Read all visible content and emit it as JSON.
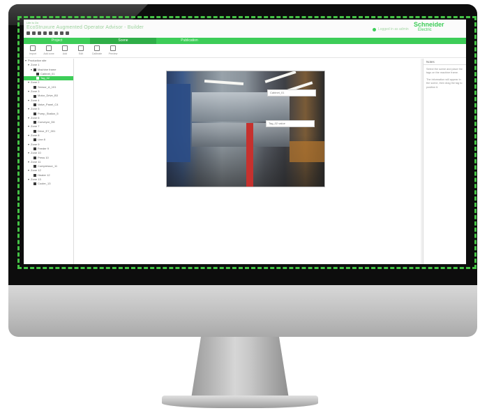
{
  "app": {
    "small_logo": "Life Is On",
    "title": "EcoStruxure Augmented Operator Advisor - Builder",
    "user_text": "Logged in as admin",
    "brand_name": "Schneider",
    "brand_sub": "Electric",
    "accent_color": "#3dcd58"
  },
  "tabs": [
    {
      "label": "Project"
    },
    {
      "label": "Scene"
    },
    {
      "label": "Publication"
    }
  ],
  "ribbon": [
    {
      "label": "Import",
      "icon": "import-icon"
    },
    {
      "label": "Add zone",
      "icon": "add-zone-icon"
    },
    {
      "label": "Add",
      "icon": "add-icon"
    },
    {
      "label": "Edit",
      "icon": "edit-icon"
    },
    {
      "label": "Calibrate",
      "icon": "calibrate-icon"
    },
    {
      "label": "Preview",
      "icon": "preview-icon"
    }
  ],
  "tree": [
    {
      "label": "Production site",
      "depth": 0,
      "caret": "▾"
    },
    {
      "label": "Zone 1",
      "depth": 1,
      "caret": "▾"
    },
    {
      "label": "Machine frame",
      "depth": 2,
      "caret": "▾"
    },
    {
      "label": "Cabinet_01",
      "depth": 3,
      "caret": ""
    },
    {
      "label": "Tag_02",
      "depth": 3,
      "caret": "",
      "selected": true
    },
    {
      "label": "Zone 2",
      "depth": 1,
      "caret": "▾"
    },
    {
      "label": "Sensor_A_101",
      "depth": 2,
      "caret": ""
    },
    {
      "label": "Zone 3",
      "depth": 1,
      "caret": "▾"
    },
    {
      "label": "Motor_Drive_B3",
      "depth": 2,
      "caret": ""
    },
    {
      "label": "Zone 4",
      "depth": 1,
      "caret": "▾"
    },
    {
      "label": "Valve_Panel_C4",
      "depth": 2,
      "caret": ""
    },
    {
      "label": "Zone 5",
      "depth": 1,
      "caret": "▾"
    },
    {
      "label": "Pump_Station_5",
      "depth": 2,
      "caret": ""
    },
    {
      "label": "Zone 6",
      "depth": 1,
      "caret": "▾"
    },
    {
      "label": "Conveyor_D6",
      "depth": 2,
      "caret": ""
    },
    {
      "label": "Zone 7",
      "depth": 1,
      "caret": "▾"
    },
    {
      "label": "Drive_E7_001",
      "depth": 2,
      "caret": ""
    },
    {
      "label": "Zone 8",
      "depth": 1,
      "caret": "▾"
    },
    {
      "label": "Line 8",
      "depth": 2,
      "caret": ""
    },
    {
      "label": "Zone 9",
      "depth": 1,
      "caret": "▾"
    },
    {
      "label": "Feeder 9",
      "depth": 2,
      "caret": ""
    },
    {
      "label": "Zone 10",
      "depth": 1,
      "caret": "▾"
    },
    {
      "label": "Press 10",
      "depth": 2,
      "caret": ""
    },
    {
      "label": "Zone 11",
      "depth": 1,
      "caret": "▾"
    },
    {
      "label": "Compressor_11",
      "depth": 2,
      "caret": ""
    },
    {
      "label": "Zone 12",
      "depth": 1,
      "caret": "▾"
    },
    {
      "label": "Heater 12",
      "depth": 2,
      "caret": ""
    },
    {
      "label": "Zone 13",
      "depth": 1,
      "caret": "▾"
    },
    {
      "label": "Cooler_13",
      "depth": 2,
      "caret": ""
    }
  ],
  "callouts": [
    {
      "text": "Cabinet_01"
    },
    {
      "text": "Tag_02 value"
    }
  ],
  "panel": {
    "title": "Notes",
    "text1": "Select the scene and place the tags on the machine frame.",
    "text2": "The information will appear in the scene, then drag the tag to position it."
  }
}
